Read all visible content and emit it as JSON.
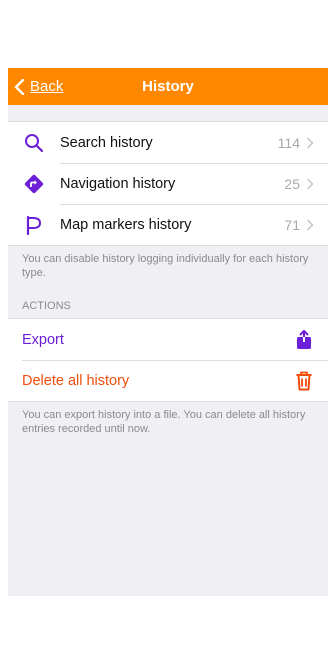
{
  "nav": {
    "back_label": "Back",
    "title": "History"
  },
  "colors": {
    "accent": "#ff8800",
    "icon": "#6b1fd6",
    "danger": "#f04d0a"
  },
  "history_items": [
    {
      "label": "Search history",
      "count": "114",
      "icon": "search-icon"
    },
    {
      "label": "Navigation history",
      "count": "25",
      "icon": "navigation-icon"
    },
    {
      "label": "Map markers history",
      "count": "71",
      "icon": "flag-icon"
    }
  ],
  "history_note": "You can disable history logging individually for each history type.",
  "actions": {
    "header": "ACTIONS",
    "export_label": "Export",
    "delete_label": "Delete all history",
    "note": "You can export history into a file. You can delete all history entries recorded until now."
  }
}
